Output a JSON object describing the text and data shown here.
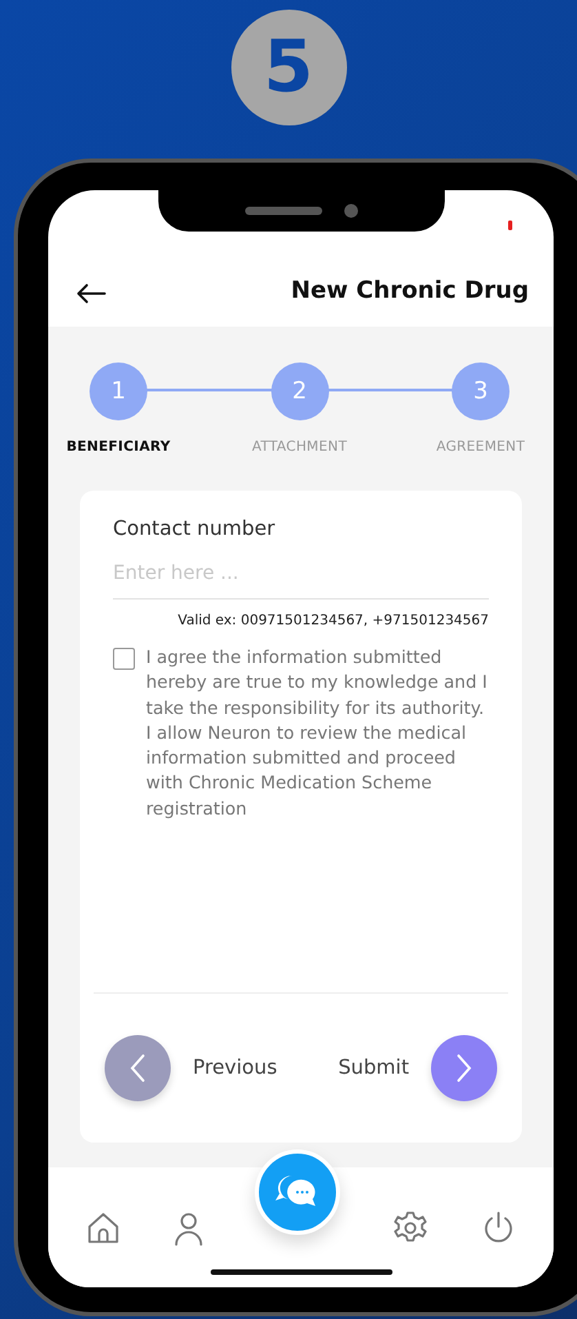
{
  "badge": "5",
  "header": {
    "title": "New Chronic Drug"
  },
  "steps": [
    {
      "number": "1",
      "label": "BENEFICIARY",
      "selected": true
    },
    {
      "number": "2",
      "label": "ATTACHMENT",
      "selected": false
    },
    {
      "number": "3",
      "label": "AGREEMENT",
      "selected": false
    }
  ],
  "form": {
    "label": "Contact number",
    "placeholder": "Enter here ...",
    "hint": "Valid ex: 00971501234567, +971501234567",
    "agreement": {
      "checked": false,
      "text": "I agree the information submitted hereby are true to my knowledge and I take the responsibility for its authority. I allow Neuron to review the medical information submitted and proceed with Chronic Medication Scheme registration"
    }
  },
  "navigation": {
    "previous": "Previous",
    "submit": "Submit"
  },
  "bottom_nav": [
    {
      "kind": "home"
    },
    {
      "kind": "profile"
    },
    {
      "kind": "chat"
    },
    {
      "kind": "settings"
    },
    {
      "kind": "power"
    }
  ]
}
